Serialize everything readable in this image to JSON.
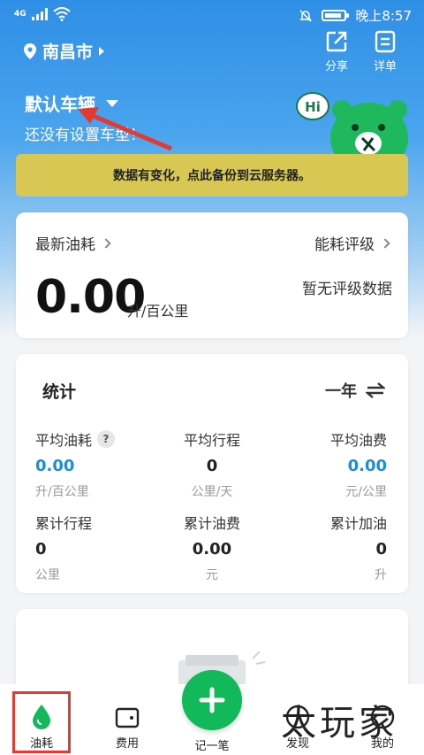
{
  "statusbar": {
    "network": "4G",
    "time": "晚上8:57"
  },
  "header": {
    "city": "南昌市",
    "share_label": "分享",
    "detail_label": "详单",
    "vehicle_title": "默认车辆",
    "vehicle_subtitle": "还没有设置车型！",
    "mascot_bubble": "Hi"
  },
  "banner": {
    "text": "数据有变化，点此备份到云服务器。"
  },
  "fuel_card": {
    "latest_label": "最新油耗",
    "rating_label": "能耗评级",
    "value": "0.00",
    "unit": "升/百公里",
    "rating_value": "暂无评级数据"
  },
  "stats": {
    "title": "统计",
    "period": "一年",
    "help_icon_text": "?",
    "items": [
      {
        "label": "平均油耗",
        "value": "0.00",
        "unit": "升/百公里"
      },
      {
        "label": "平均行程",
        "value": "0",
        "unit": "公里/天"
      },
      {
        "label": "平均油费",
        "value": "0.00",
        "unit": "元/公里"
      },
      {
        "label": "累计行程",
        "value": "0",
        "unit": "公里"
      },
      {
        "label": "累计油费",
        "value": "0.00",
        "unit": "元"
      },
      {
        "label": "累计加油",
        "value": "0",
        "unit": "升"
      }
    ]
  },
  "nav": {
    "items": [
      {
        "label": "油耗"
      },
      {
        "label": "费用"
      },
      {
        "label": "记一笔"
      },
      {
        "label": "发现"
      },
      {
        "label": "我的"
      }
    ]
  },
  "watermark": "太玩家",
  "colors": {
    "primary": "#2f8fe6",
    "accent_green": "#12b95a",
    "value_blue": "#1a8fd6",
    "banner": "#d8c853",
    "highlight_red": "#e53a2f"
  }
}
